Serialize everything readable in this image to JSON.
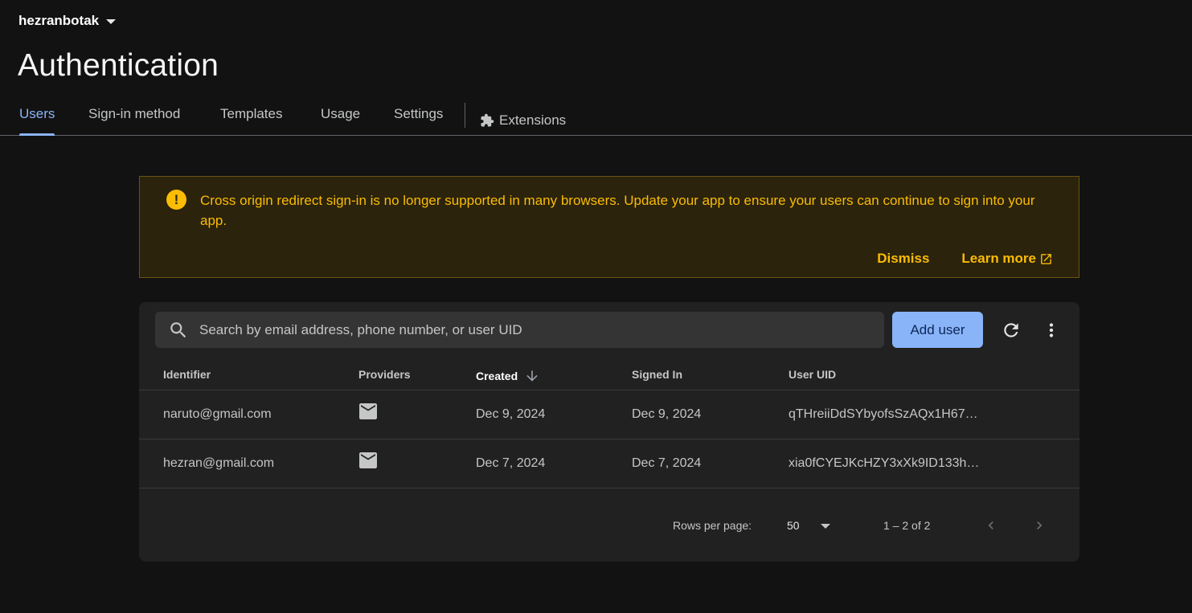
{
  "project": {
    "name": "hezranbotak"
  },
  "page": {
    "title": "Authentication"
  },
  "tabs": [
    {
      "label": "Users",
      "active": true
    },
    {
      "label": "Sign-in method"
    },
    {
      "label": "Templates"
    },
    {
      "label": "Usage"
    },
    {
      "label": "Settings"
    },
    {
      "label": "Extensions",
      "icon": "puzzle-icon"
    }
  ],
  "banner": {
    "message": "Cross origin redirect sign-in is no longer supported in many browsers. Update your app to ensure your users can continue to sign into your app.",
    "dismiss_label": "Dismiss",
    "learn_more_label": "Learn more",
    "color": "#fbbc04"
  },
  "toolbar": {
    "search_placeholder": "Search by email address, phone number, or user UID",
    "add_user_label": "Add user"
  },
  "table": {
    "columns": [
      "Identifier",
      "Providers",
      "Created",
      "Signed In",
      "User UID"
    ],
    "sorted_column": "Created",
    "rows": [
      {
        "identifier": "naruto@gmail.com",
        "provider": "mail-icon",
        "created": "Dec 9, 2024",
        "signed_in": "Dec 9, 2024",
        "uid": "qTHreiiDdSYbyofsSzAQx1H67…"
      },
      {
        "identifier": "hezran@gmail.com",
        "provider": "mail-icon",
        "created": "Dec 7, 2024",
        "signed_in": "Dec 7, 2024",
        "uid": "xia0fCYEJKcHZY3xXk9ID133h…"
      }
    ]
  },
  "pagination": {
    "rows_per_page_label": "Rows per page:",
    "rows_per_page": "50",
    "range": "1 – 2 of 2"
  },
  "colors": {
    "accent": "#8ab4f8",
    "background": "#121212",
    "card": "#212121",
    "warning": "#fbbc04"
  }
}
